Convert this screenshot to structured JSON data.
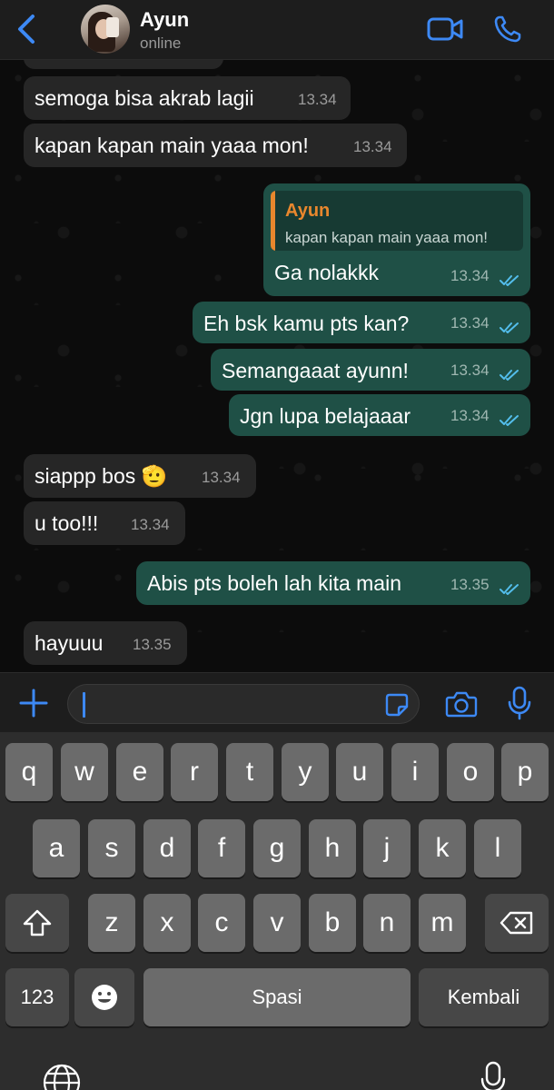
{
  "header": {
    "back_icon": "chevron-left-icon",
    "contact_name": "Ayun",
    "status": "online",
    "video_icon": "video-camera-icon",
    "call_icon": "phone-icon",
    "accent": "#3d89f5"
  },
  "messages": [
    {
      "dir": "in",
      "text": "semoga bisa akrab lagii",
      "time": "13.34"
    },
    {
      "dir": "in",
      "text": "kapan kapan main yaaa mon!",
      "time": "13.34"
    },
    {
      "dir": "out",
      "reply_to": {
        "name": "Ayun",
        "text": "kapan kapan main yaaa mon!"
      },
      "text": "Ga nolakkk",
      "time": "13.34",
      "read": true
    },
    {
      "dir": "out",
      "text": "Eh bsk kamu pts kan?",
      "time": "13.34",
      "read": true
    },
    {
      "dir": "out",
      "text": "Semangaaat ayunn!",
      "time": "13.34",
      "read": true
    },
    {
      "dir": "out",
      "text": "Jgn lupa belajaaar",
      "time": "13.34",
      "read": true
    },
    {
      "dir": "in",
      "text": "siappp bos 🫡",
      "time": "13.34"
    },
    {
      "dir": "in",
      "text": "u too!!!",
      "time": "13.34"
    },
    {
      "dir": "out",
      "text": "Abis pts boleh lah kita main",
      "time": "13.35",
      "read": true
    },
    {
      "dir": "in",
      "text": "hayuuu",
      "time": "13.35"
    }
  ],
  "input_bar": {
    "plus_icon": "plus-icon",
    "text_value": "",
    "sticker_icon": "sticker-icon",
    "camera_icon": "camera-icon",
    "mic_icon": "microphone-icon"
  },
  "keyboard": {
    "row1": [
      "q",
      "w",
      "e",
      "r",
      "t",
      "y",
      "u",
      "i",
      "o",
      "p"
    ],
    "row2": [
      "a",
      "s",
      "d",
      "f",
      "g",
      "h",
      "j",
      "k",
      "l"
    ],
    "row3": [
      "z",
      "x",
      "c",
      "v",
      "b",
      "n",
      "m"
    ],
    "shift_icon": "shift-icon",
    "backspace_icon": "backspace-icon",
    "numbers_label": "123",
    "emoji_icon": "emoji-icon",
    "space_label": "Spasi",
    "return_label": "Kembali",
    "globe_icon": "globe-icon",
    "dictation_icon": "microphone-icon"
  },
  "colors": {
    "incoming_bubble": "#262626",
    "outgoing_bubble": "#1f5046",
    "reply_accent": "#e8872d",
    "read_ticks": "#53bdeb"
  }
}
